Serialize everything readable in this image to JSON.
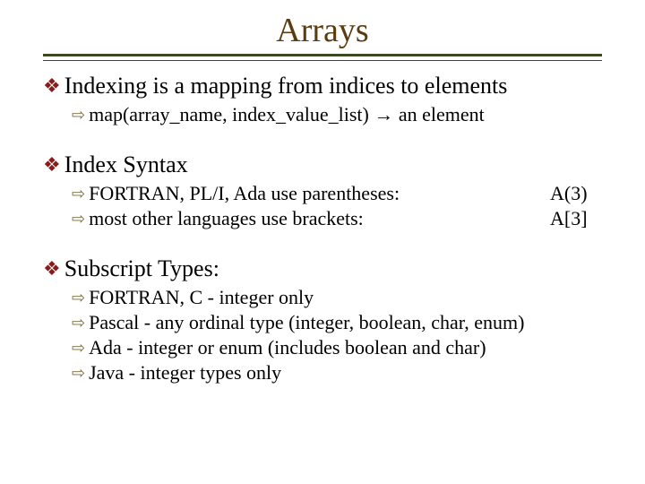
{
  "title": "Arrays",
  "sections": [
    {
      "heading": "Indexing is a mapping from indices to elements",
      "items": [
        {
          "text": "map(array_name, index_value_list) →  an element",
          "right": ""
        }
      ]
    },
    {
      "heading": "Index Syntax",
      "items": [
        {
          "text": "FORTRAN, PL/I, Ada use parentheses:",
          "right": "A(3)"
        },
        {
          "text": "most other languages use brackets:",
          "right": "A[3]"
        }
      ]
    },
    {
      "heading": "Subscript Types:",
      "items": [
        {
          "text": "FORTRAN, C - integer only",
          "right": ""
        },
        {
          "text": "Pascal - any ordinal type (integer, boolean, char, enum)",
          "right": ""
        },
        {
          "text": "Ada - integer or enum (includes boolean and char)",
          "right": ""
        },
        {
          "text": "Java - integer types only",
          "right": ""
        }
      ]
    }
  ]
}
